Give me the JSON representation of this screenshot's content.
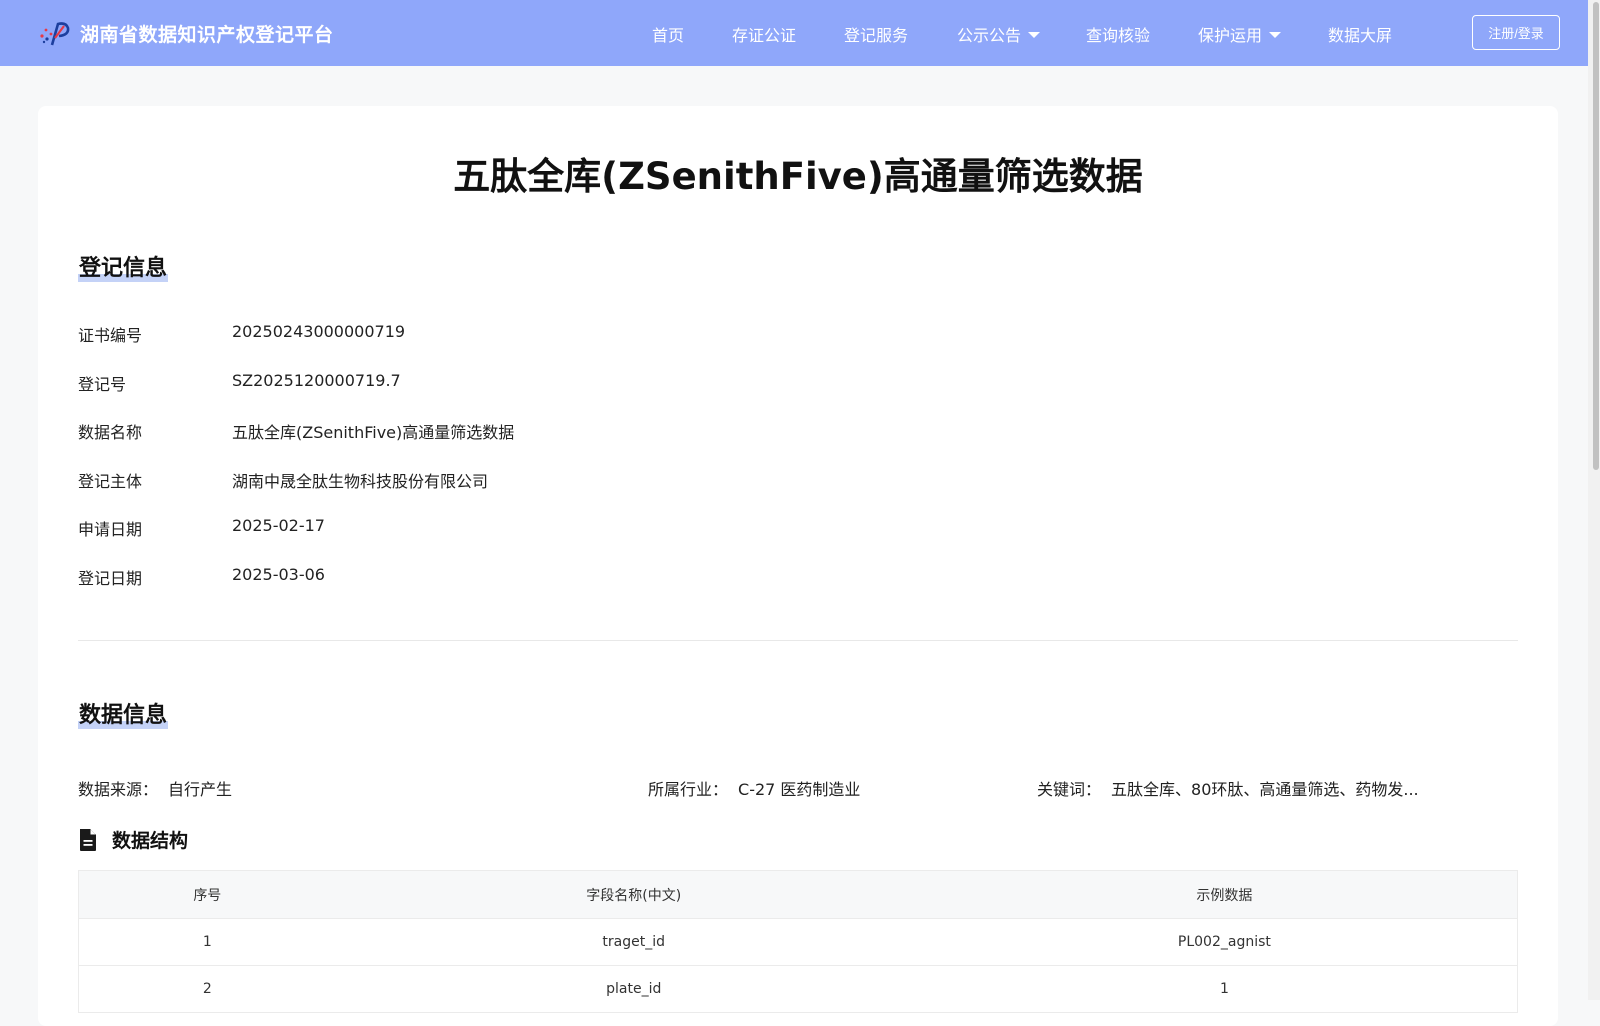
{
  "header": {
    "site_title": "湖南省数据知识产权登记平台",
    "nav": [
      {
        "label": "首页"
      },
      {
        "label": "存证公证"
      },
      {
        "label": "登记服务"
      },
      {
        "label": "公示公告",
        "dropdown": true
      },
      {
        "label": "查询核验"
      },
      {
        "label": "保护运用",
        "dropdown": true
      },
      {
        "label": "数据大屏"
      }
    ],
    "login_label": "注册/登录"
  },
  "page": {
    "title": "五肽全库(ZSenithFive)高通量筛选数据"
  },
  "registration": {
    "section_title": "登记信息",
    "rows": [
      {
        "label": "证书编号",
        "value": "20250243000000719"
      },
      {
        "label": "登记号",
        "value": "SZ2025120000719.7"
      },
      {
        "label": "数据名称",
        "value": "五肽全库(ZSenithFive)高通量筛选数据"
      },
      {
        "label": "登记主体",
        "value": "湖南中晟全肽生物科技股份有限公司"
      },
      {
        "label": "申请日期",
        "value": "2025-02-17"
      },
      {
        "label": "登记日期",
        "value": "2025-03-06"
      }
    ]
  },
  "data_info": {
    "section_title": "数据信息",
    "source_label": "数据来源：",
    "source_value": "自行产生",
    "industry_label": "所属行业：",
    "industry_value": "C-27 医药制造业",
    "keywords_label": "关键词：",
    "keywords_value": "五肽全库、80环肽、高通量筛选、药物发..."
  },
  "structure": {
    "title": "数据结构",
    "icon": "document-icon",
    "columns": [
      "序号",
      "字段名称(中文)",
      "示例数据"
    ],
    "rows": [
      [
        "1",
        "traget_id",
        "PL002_agnist"
      ],
      [
        "2",
        "plate_id",
        "1"
      ]
    ]
  },
  "colors": {
    "header_bg": "#8fa7fa",
    "title_highlight": "#c4d2f7",
    "page_bg": "#f7f8f9"
  }
}
